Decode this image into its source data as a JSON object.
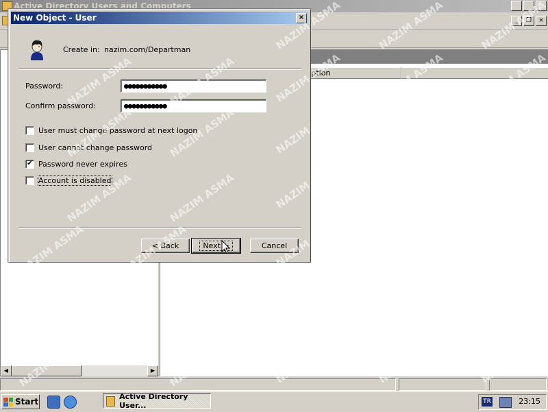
{
  "background_window": {
    "title": "Active Directory Users and Computers",
    "column_header_partial": "scription"
  },
  "dialog": {
    "title": "New Object - User",
    "close_glyph": "×",
    "create_in_label": "Create in:",
    "create_in_value": "nazim.com/Departman",
    "password_label": "Password:",
    "password_value": "●●●●●●●●●●●",
    "confirm_label": "Confirm password:",
    "confirm_value": "●●●●●●●●●●●",
    "options": [
      {
        "label": "User must change password at next logon",
        "checked": false
      },
      {
        "label": "User cannot change password",
        "checked": false
      },
      {
        "label": "Password never expires",
        "checked": true
      },
      {
        "label": "Account is disabled",
        "checked": false
      }
    ],
    "back_label": "< Back",
    "next_label": "Next >",
    "cancel_label": "Cancel"
  },
  "taskbar": {
    "start_label": "Start",
    "task_label": "Active Directory User...",
    "language": "TR",
    "clock": "23:15"
  },
  "watermark": "NAZIM ASMA",
  "icons": [
    "folder-icon",
    "user-icon",
    "close-icon",
    "ie-icon",
    "network-icon",
    "mouse-cursor-icon"
  ],
  "colors": {
    "title_active": "#0a246a",
    "title_gradient_end": "#a6caf0",
    "face": "#d4d0c8"
  }
}
